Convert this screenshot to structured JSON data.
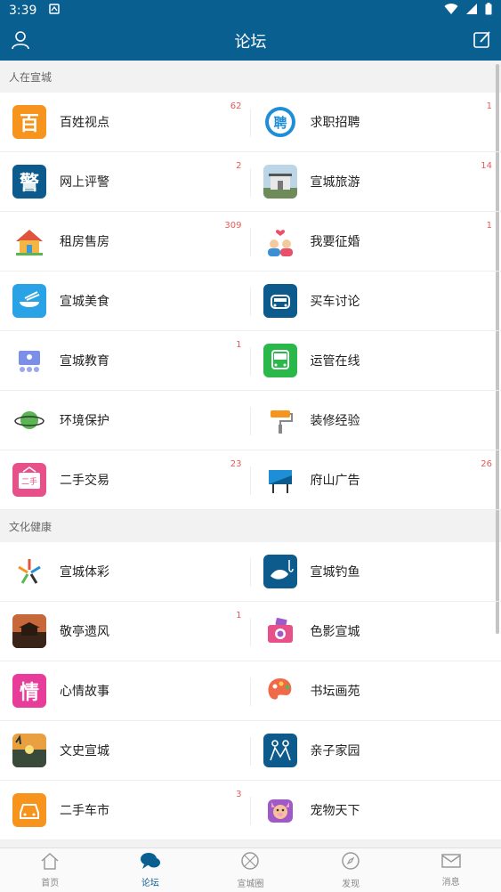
{
  "status": {
    "time": "3:39"
  },
  "header": {
    "title": "论坛"
  },
  "sections": [
    {
      "title": "人在宣城",
      "items": [
        {
          "label": "百姓视点",
          "count": "62"
        },
        {
          "label": "求职招聘",
          "count": "1"
        },
        {
          "label": "网上评警",
          "count": "2"
        },
        {
          "label": "宣城旅游",
          "count": "14"
        },
        {
          "label": "租房售房",
          "count": "309"
        },
        {
          "label": "我要征婚",
          "count": "1"
        },
        {
          "label": "宣城美食",
          "count": ""
        },
        {
          "label": "买车讨论",
          "count": ""
        },
        {
          "label": "宣城教育",
          "count": "1"
        },
        {
          "label": "运管在线",
          "count": ""
        },
        {
          "label": "环境保护",
          "count": ""
        },
        {
          "label": "装修经验",
          "count": ""
        },
        {
          "label": "二手交易",
          "count": "23"
        },
        {
          "label": "府山广告",
          "count": "26"
        }
      ]
    },
    {
      "title": "文化健康",
      "items": [
        {
          "label": "宣城体彩",
          "count": ""
        },
        {
          "label": "宣城钓鱼",
          "count": ""
        },
        {
          "label": "敬亭遗风",
          "count": "1"
        },
        {
          "label": "色影宣城",
          "count": ""
        },
        {
          "label": "心情故事",
          "count": ""
        },
        {
          "label": "书坛画苑",
          "count": ""
        },
        {
          "label": "文史宣城",
          "count": ""
        },
        {
          "label": "亲子家园",
          "count": ""
        },
        {
          "label": "二手车市",
          "count": "3"
        },
        {
          "label": "宠物天下",
          "count": ""
        }
      ]
    }
  ],
  "icon_glyphs": {
    "baixing": "百",
    "jing": "警",
    "pin": "聘",
    "qing": "情",
    "ershou": "二手"
  },
  "tabs": [
    {
      "label": "首页",
      "icon": "home-icon"
    },
    {
      "label": "论坛",
      "icon": "chat-icon"
    },
    {
      "label": "宣城圈",
      "icon": "circle-icon"
    },
    {
      "label": "发现",
      "icon": "compass-icon"
    },
    {
      "label": "消息",
      "icon": "mail-icon"
    }
  ],
  "colors": {
    "primary": "#0a5f91",
    "badge": "#e85a5a",
    "active_tab": "#0a5f91"
  }
}
